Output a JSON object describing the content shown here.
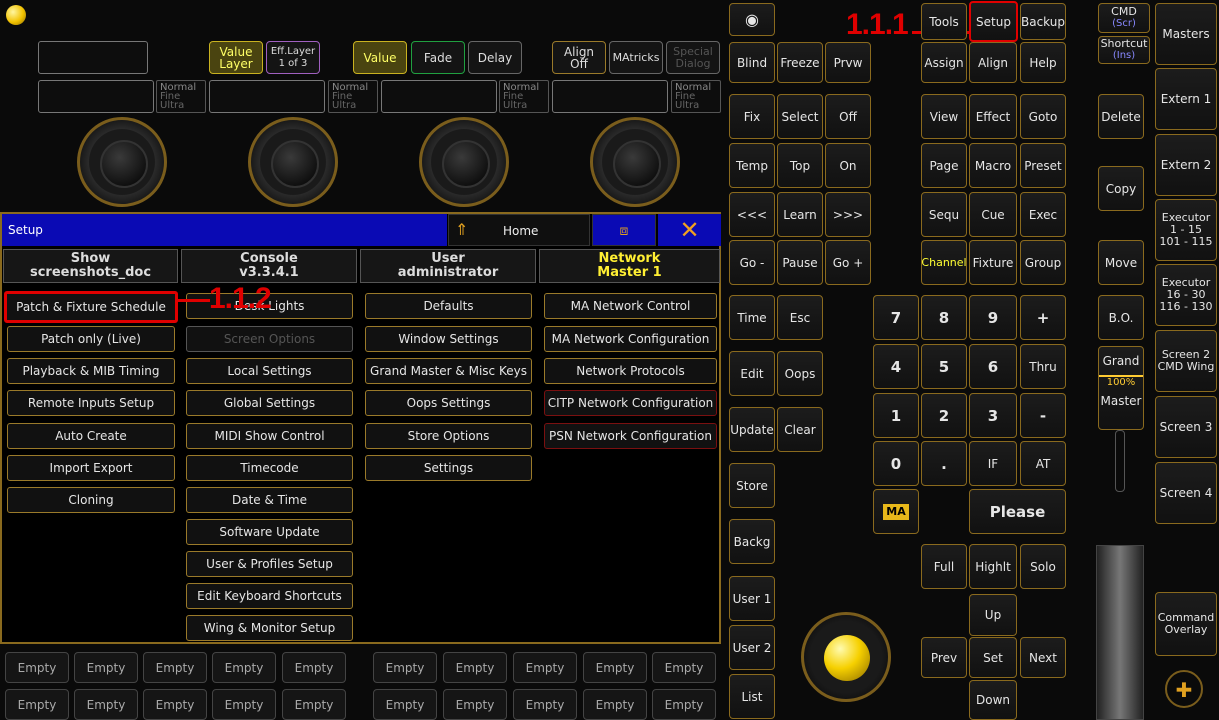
{
  "top_controls": {
    "value_layer": "Value\nLayer",
    "eff_layer": "Eff.Layer\n1 of 3",
    "value": "Value",
    "fade": "Fade",
    "delay": "Delay",
    "align_off": "Align\nOff",
    "matricks": "MAtricks",
    "special_dialog": "Special\nDialog",
    "resolution": [
      "Normal",
      "Fine",
      "Ultra"
    ]
  },
  "window": {
    "title": "Setup",
    "home": "Home",
    "columns": [
      {
        "head1": "Show",
        "head2": "screenshots_doc",
        "items": [
          "Patch & Fixture Schedule",
          "Patch only (Live)",
          "Playback & MIB Timing",
          "Remote Inputs Setup",
          "Auto Create",
          "Import Export",
          "Cloning"
        ]
      },
      {
        "head1": "Console",
        "head2": "v3.3.4.1",
        "items": [
          "Desk Lights",
          "Screen Options",
          "Local Settings",
          "Global Settings",
          "MIDI Show Control",
          "Timecode",
          "Date & Time",
          "Software Update",
          "User & Profiles Setup",
          "Edit Keyboard Shortcuts",
          "Wing & Monitor Setup"
        ]
      },
      {
        "head1": "User",
        "head2": "administrator",
        "items": [
          "Defaults",
          "Window Settings",
          "Grand Master & Misc Keys",
          "Oops Settings",
          "Store Options",
          "Settings"
        ]
      },
      {
        "head1": "Network",
        "head2": "Master 1",
        "items": [
          "MA Network Control",
          "MA Network Configuration",
          "Network Protocols",
          "CITP Network Configuration",
          "PSN Network Configuration"
        ]
      }
    ]
  },
  "callouts": {
    "setup": "1.1.1",
    "patch": "1.1.2"
  },
  "executor_empty": "Empty",
  "keys": {
    "blind": "Blind",
    "freeze": "Freeze",
    "prvw": "Prvw",
    "fix": "Fix",
    "select": "Select",
    "off": "Off",
    "temp": "Temp",
    "top": "Top",
    "on": "On",
    "prev_page": "<<<",
    "learn": "Learn",
    "next_page": ">>>",
    "go_minus": "Go -",
    "pause": "Pause",
    "go_plus": "Go +",
    "time": "Time",
    "esc": "Esc",
    "edit": "Edit",
    "oops": "Oops",
    "update": "Update",
    "clear": "Clear",
    "store": "Store",
    "backg": "Backg",
    "user1": "User 1",
    "user2": "User 2",
    "list": "List",
    "tools": "Tools",
    "setup": "Setup",
    "backup": "Backup",
    "assign": "Assign",
    "align": "Align",
    "help": "Help",
    "view": "View",
    "effect": "Effect",
    "goto": "Goto",
    "page": "Page",
    "macro": "Macro",
    "preset": "Preset",
    "sequ": "Sequ",
    "cue": "Cue",
    "exec": "Exec",
    "channel": "Channel",
    "fixture": "Fixture",
    "group": "Group",
    "k7": "7",
    "k8": "8",
    "k9": "9",
    "plus": "+",
    "k4": "4",
    "k5": "5",
    "k6": "6",
    "thru": "Thru",
    "k1": "1",
    "k2": "2",
    "k3": "3",
    "minus": "-",
    "k0": "0",
    "dot": ".",
    "if": "IF",
    "at": "AT",
    "ma": "MA",
    "please": "Please",
    "full": "Full",
    "highlt": "Highlt",
    "solo": "Solo",
    "up": "Up",
    "prev": "Prev",
    "set": "Set",
    "next": "Next",
    "down": "Down",
    "cmd": "CMD",
    "cmd_sub": "(Scr)",
    "shortcut": "Shortcut",
    "shortcut_sub": "(Ins)",
    "delete": "Delete",
    "copy": "Copy",
    "move": "Move",
    "bo": "B.O.",
    "grand": "Grand",
    "grand_level": "100%",
    "master": "Master",
    "masters": "Masters",
    "extern1": "Extern 1",
    "extern2": "Extern 2",
    "exec1": "Executor\n1 - 15\n101 - 115",
    "exec2": "Executor\n16 - 30\n116 - 130",
    "screen2": "Screen 2\nCMD Wing",
    "screen3": "Screen 3",
    "screen4": "Screen 4",
    "cmd_overlay": "Command\nOverlay"
  }
}
